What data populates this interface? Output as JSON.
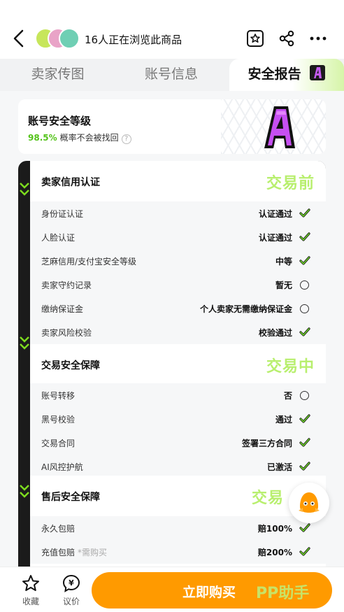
{
  "header": {
    "title": "16人正在浏览此商品"
  },
  "tabs": [
    {
      "label": "卖家传图"
    },
    {
      "label": "账号信息"
    },
    {
      "label": "安全报告",
      "badge": "A"
    }
  ],
  "level": {
    "title": "账号安全等级",
    "percent": "98.5%",
    "desc": "概率不会被找回",
    "grade": "A"
  },
  "sections": [
    {
      "title": "卖家信用认证",
      "stamp": "交易前",
      "rows": [
        {
          "label": "身份证认证",
          "value": "认证通过",
          "status": "check"
        },
        {
          "label": "人脸认证",
          "value": "认证通过",
          "status": "check"
        },
        {
          "label": "芝麻信用/支付宝安全等级",
          "value": "中等",
          "status": "check"
        },
        {
          "label": "卖家守约记录",
          "value": "暂无",
          "status": "circle"
        },
        {
          "label": "缴纳保证金",
          "value": "个人卖家无需缴纳保证金",
          "status": "circle"
        },
        {
          "label": "卖家风险校验",
          "value": "校验通过",
          "status": "check"
        }
      ]
    },
    {
      "title": "交易安全保障",
      "stamp": "交易中",
      "rows": [
        {
          "label": "账号转移",
          "value": "否",
          "status": "circle"
        },
        {
          "label": "黑号校验",
          "value": "通过",
          "status": "check"
        },
        {
          "label": "交易合同",
          "value": "签署三方合同",
          "status": "check"
        },
        {
          "label": "AI风控护航",
          "value": "已激活",
          "status": "check"
        }
      ]
    },
    {
      "title": "售后安全保障",
      "stamp": "交易",
      "rows": [
        {
          "label": "永久包赔",
          "value": "赔100%",
          "status": "check"
        },
        {
          "label": "充值包赔",
          "note": "*需购买",
          "value": "赔200%",
          "status": "check"
        }
      ]
    }
  ],
  "bottom": {
    "fav_label": "收藏",
    "talk_label": "议价",
    "buy_label": "立即购买",
    "watermark": "PP助手"
  },
  "colors": {
    "accent_green": "#54c31a",
    "check_green": "#2fb82f",
    "buy_orange": "#ff9a00",
    "stamp_green": "#b8ef6e",
    "grade_purple": "#b63ce6"
  }
}
